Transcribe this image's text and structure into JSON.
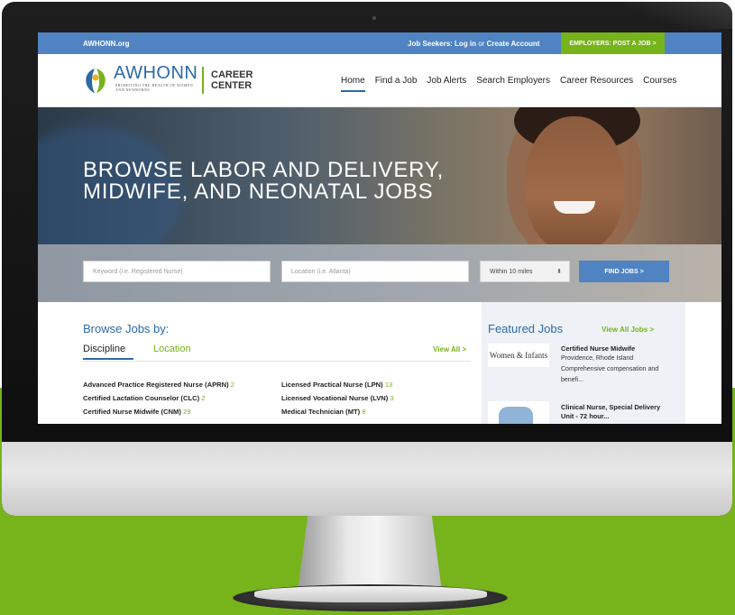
{
  "topbar": {
    "brand": "AWHONN.org",
    "seekers_label": "Job Seekers:",
    "login": "Log in",
    "or": "or",
    "create_account": "Create Account",
    "employers_cta": "EMPLOYERS: POST A JOB  >"
  },
  "header": {
    "logo_text": "AWHONN",
    "logo_tagline": "PROMOTING THE HEALTH OF WOMEN AND NEWBORNS",
    "career_line1": "CAREER",
    "career_line2": "CENTER",
    "nav": [
      "Home",
      "Find a Job",
      "Job Alerts",
      "Search Employers",
      "Career Resources",
      "Courses"
    ]
  },
  "hero": {
    "headline_line1": "BROWSE LABOR AND DELIVERY,",
    "headline_line2": "MIDWIFE, AND NEONATAL JOBS"
  },
  "search": {
    "keyword_placeholder": "Keyword (i.e. Registered Nurse)",
    "location_placeholder": "Location (i.e. Atlanta)",
    "radius_selected": "Within 10 miles",
    "find_button": "FIND JOBS  >"
  },
  "browse": {
    "title": "Browse Jobs by:",
    "tab_discipline": "Discipline",
    "tab_location": "Location",
    "view_all": "View All  >",
    "col1": [
      {
        "name": "Advanced Practice Registered Nurse (APRN)",
        "count": "2"
      },
      {
        "name": "Certified Lactation Counselor (CLC)",
        "count": "2"
      },
      {
        "name": "Certified Nurse Midwife (CNM)",
        "count": "29"
      }
    ],
    "col2": [
      {
        "name": "Licensed Practical Nurse (LPN)",
        "count": "13"
      },
      {
        "name": "Licensed Vocational Nurse (LVN)",
        "count": "3"
      },
      {
        "name": "Medical Technician (MT)",
        "count": "8"
      }
    ]
  },
  "featured": {
    "title": "Featured Jobs",
    "view_all": "View All Jobs  >",
    "jobs": [
      {
        "logo_text": "Women & Infants",
        "title": "Certified Nurse Midwife",
        "location": "Providence, Rhode Island",
        "snippet": "Comprehensive compensation and benefi..."
      },
      {
        "logo_text": "",
        "title": "Clinical Nurse, Special Delivery Unit - 72 hour..."
      }
    ]
  },
  "colors": {
    "primary_blue": "#4f83c2",
    "brand_green": "#77b31b",
    "heading_blue": "#2c6aa8"
  }
}
